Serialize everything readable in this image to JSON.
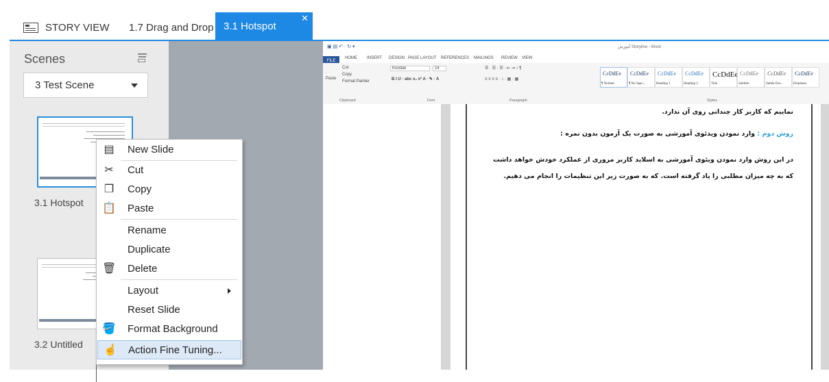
{
  "tabs": [
    {
      "label": "STORY VIEW"
    },
    {
      "label": "1.7 Drag and Drop"
    },
    {
      "label": "3.1 Hotspot"
    }
  ],
  "scenes_panel": {
    "title": "Scenes",
    "scene_select": "3 Test Scene",
    "slides": [
      {
        "label": "3.1 Hotspot"
      },
      {
        "label": "3.2 Untitled"
      }
    ]
  },
  "context_menu": {
    "items": [
      {
        "label": "New Slide",
        "icon": "new-slide-icon"
      },
      {
        "label": "Cut",
        "icon": "scissors-icon"
      },
      {
        "label": "Copy",
        "icon": "copy-icon"
      },
      {
        "label": "Paste",
        "icon": "paste-icon"
      },
      {
        "label": "Rename"
      },
      {
        "label": "Duplicate"
      },
      {
        "label": "Delete",
        "icon": "trash-icon"
      },
      {
        "label": "Layout",
        "submenu": true
      },
      {
        "label": "Reset Slide"
      },
      {
        "label": "Format Background",
        "icon": "paint-bucket-icon"
      },
      {
        "label": "Action Fine Tuning...",
        "icon": "hand-cursor-icon"
      }
    ]
  },
  "word": {
    "window_title": "آموزش Storyline - Word",
    "ribbon_tabs": [
      "FILE",
      "HOME",
      "INSERT",
      "DESIGN",
      "PAGE LAYOUT",
      "REFERENCES",
      "MAILINGS",
      "REVIEW",
      "VIEW"
    ],
    "clipboard": {
      "paste": "Paste",
      "cut": "Cut",
      "copy": "Copy",
      "format_painter": "Format Painter",
      "group": "Clipboard"
    },
    "font": {
      "name": "Koodak",
      "size": "14",
      "group": "Font"
    },
    "paragraph_group": "Paragraph",
    "styles_group": "Styles",
    "styles": [
      {
        "sample": "CcDdEe",
        "name": "¶ Normal"
      },
      {
        "sample": "CcDdEe",
        "name": "¶ No Spac..."
      },
      {
        "sample": "CcDdEe",
        "name": "Heading 1"
      },
      {
        "sample": "CcDdEe",
        "name": "Heading 2"
      },
      {
        "sample": "CcDdEe",
        "name": "Title"
      },
      {
        "sample": "CcDdEe",
        "name": "Subtitle"
      },
      {
        "sample": "CcDdEe",
        "name": "Subtle Em..."
      },
      {
        "sample": "CcDdEe",
        "name": "Emphasis"
      }
    ],
    "doc_lines": [
      {
        "text": "نماییم که کاربر کار چندانی روی آن ندارد."
      },
      {
        "blue": "روش دوم :",
        "text": " وارد نمودن ویدئوی آموزشی به صورت یک آزمون بدون نمره :"
      },
      {
        "text": "در این روش وارد نمودن ویئوی آموزشی به اسلاید کاربر مروری از عملکرد خودش خواهد داشت"
      },
      {
        "text": "که به چه میزان مطلبی را یاد گرفته است. که به صورت زیر این تنظیمات را انجام می دهیم."
      }
    ]
  }
}
